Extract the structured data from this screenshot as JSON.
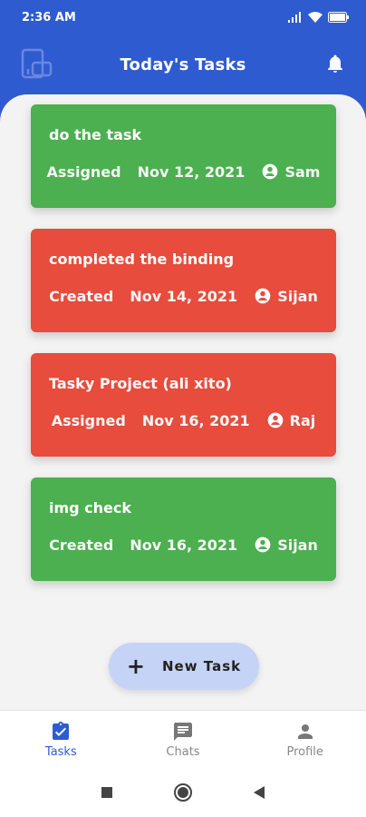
{
  "status_bar": {
    "time": "2:36 AM"
  },
  "app_bar": {
    "title": "Today's Tasks"
  },
  "tasks": [
    {
      "title": "do the task",
      "status": "Assigned",
      "date": "Nov 12, 2021",
      "assignee": "Sam",
      "color": "#4caf50"
    },
    {
      "title": "completed the binding",
      "status": "Created",
      "date": "Nov 14, 2021",
      "assignee": "Sijan",
      "color": "#e74c3c"
    },
    {
      "title": "Tasky Project (ali xito)",
      "status": "Assigned",
      "date": "Nov 16, 2021",
      "assignee": "Raj",
      "color": "#e74c3c"
    },
    {
      "title": "img check",
      "status": "Created",
      "date": "Nov 16, 2021",
      "assignee": "Sijan",
      "color": "#4caf50"
    }
  ],
  "new_task_button": {
    "label": "New Task",
    "icon": "plus-icon"
  },
  "bottom_nav": [
    {
      "label": "Tasks",
      "icon": "task-clipboard-icon",
      "active": true
    },
    {
      "label": "Chats",
      "icon": "chat-icon",
      "active": false
    },
    {
      "label": "Profile",
      "icon": "person-icon",
      "active": false
    }
  ],
  "colors": {
    "primary": "#2f5bd1",
    "success": "#4caf50",
    "danger": "#e74c3c",
    "fab": "#c5d3f6"
  }
}
